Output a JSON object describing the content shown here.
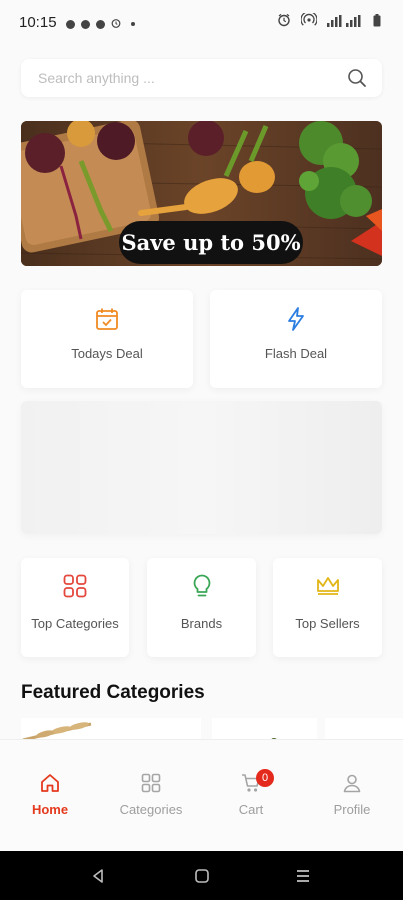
{
  "status_bar": {
    "time": "10:15"
  },
  "search": {
    "placeholder": "Search anything ..."
  },
  "banner": {
    "promo_text": "Save up to 50%"
  },
  "deals": [
    {
      "label": "Todays Deal",
      "icon": "calendar-check-icon",
      "color": "#f08a24"
    },
    {
      "label": "Flash Deal",
      "icon": "lightning-icon",
      "color": "#2a7de1"
    }
  ],
  "quick_links": [
    {
      "label": "Top Categories",
      "icon": "grid-icon",
      "color": "#e4473c"
    },
    {
      "label": "Brands",
      "icon": "lightbulb-icon",
      "color": "#3aa655"
    },
    {
      "label": "Top Sellers",
      "icon": "crown-icon",
      "color": "#e2b617"
    }
  ],
  "featured": {
    "title": "Featured Categories"
  },
  "bottom_nav": {
    "items": [
      {
        "label": "Home",
        "icon": "home-icon",
        "active": true
      },
      {
        "label": "Categories",
        "icon": "categories-icon",
        "active": false
      },
      {
        "label": "Cart",
        "icon": "cart-icon",
        "active": false,
        "badge": "0"
      },
      {
        "label": "Profile",
        "icon": "profile-icon",
        "active": false
      }
    ]
  },
  "colors": {
    "accent": "#e43a1e",
    "background": "#fafafa"
  }
}
